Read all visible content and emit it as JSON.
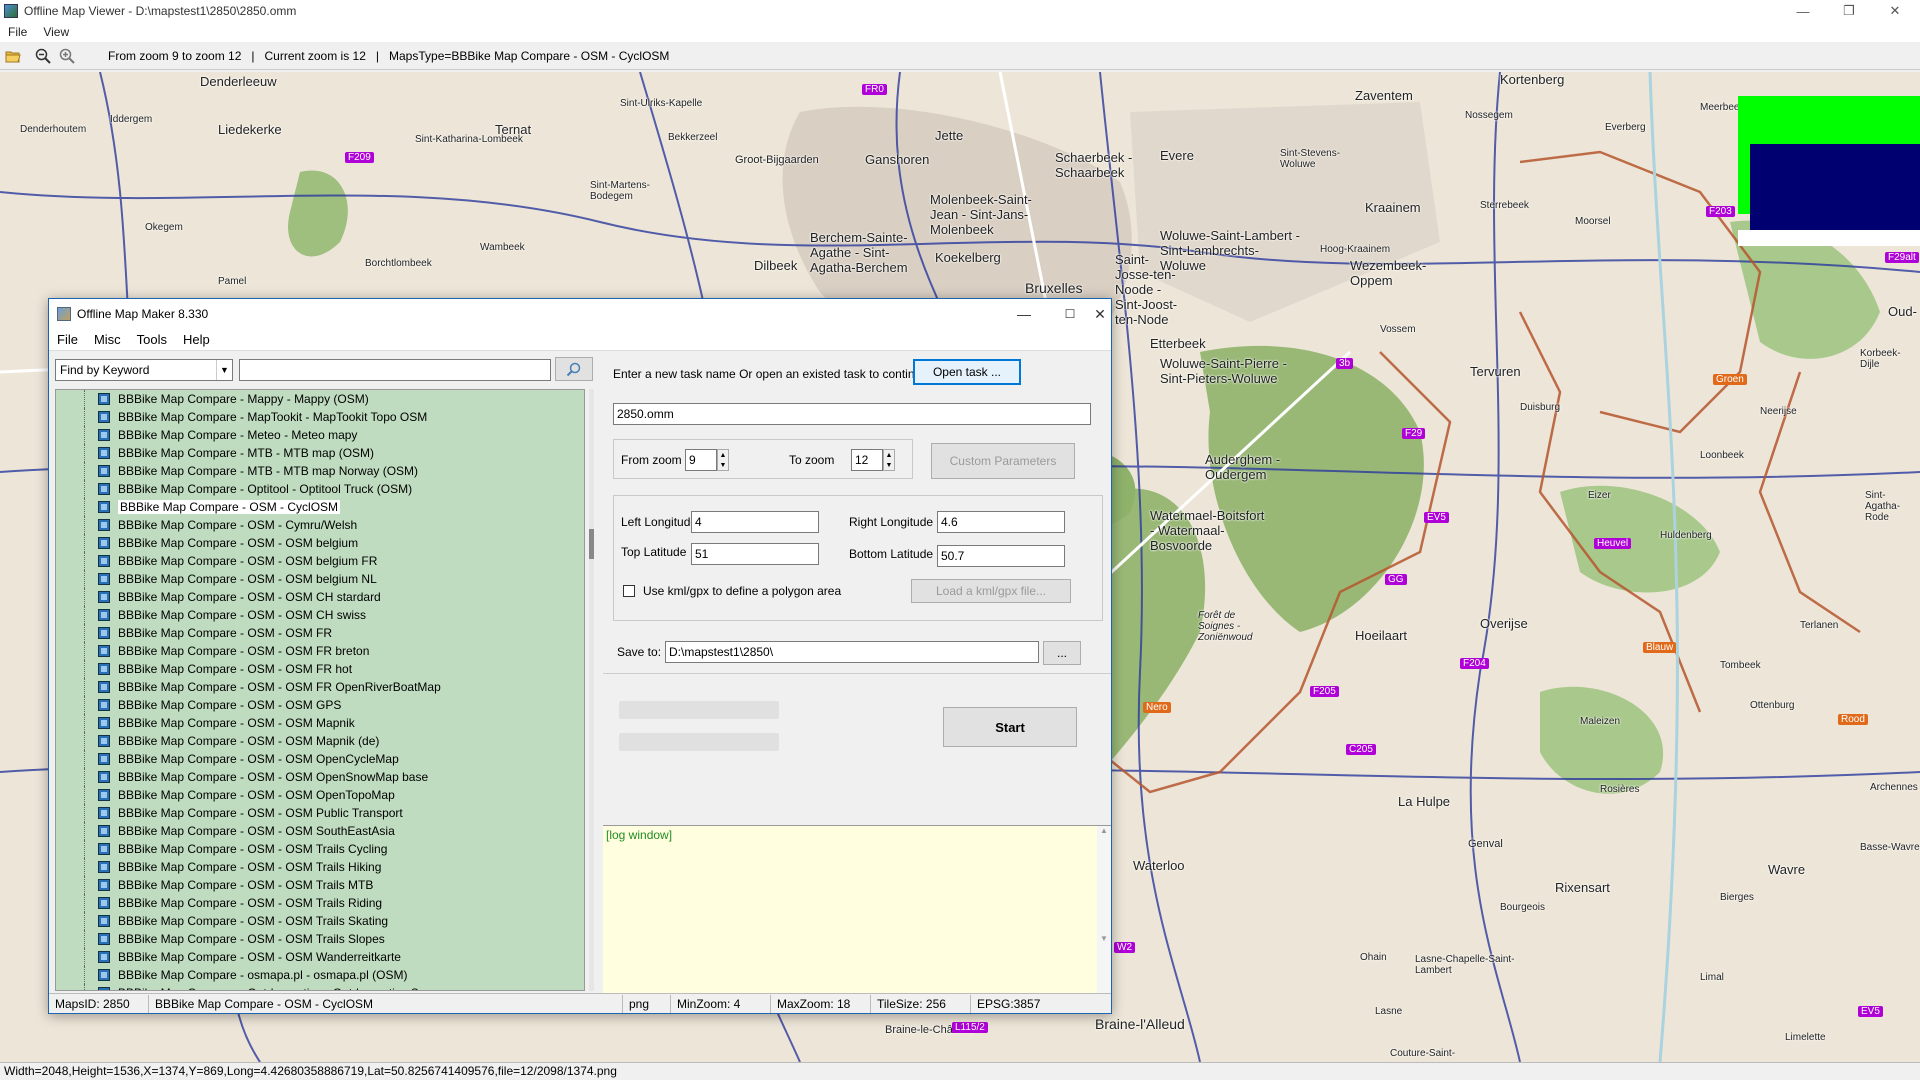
{
  "window": {
    "title": "Offline Map Viewer - D:\\mapstest1\\2850\\2850.omm",
    "controls": [
      "minimize-icon",
      "maximize-icon",
      "close-icon"
    ]
  },
  "menubar": [
    "File",
    "View"
  ],
  "toolbar": {
    "icons": [
      "open-folder-icon",
      "zoom-out-icon",
      "zoom-in-icon"
    ],
    "zoom_range": "From zoom 9 to zoom 12",
    "current_zoom": "Current zoom is 12",
    "maps_type": "MapsType=BBBike Map Compare - OSM - CyclOSM"
  },
  "map": {
    "places": [
      "Denderleeuw",
      "Liedekerke",
      "Ternat",
      "Denderhoutem",
      "Iddergem",
      "Okegem",
      "Pamel",
      "Borchtlombeek",
      "Sint-Ulriks-Kapelle",
      "Sint-Katharina-Lombeek",
      "Bekkerzeel",
      "Groot-Bijgaarden",
      "Ganshoren",
      "Jette",
      "Sint-Martens-Bodegem",
      "Wambeek",
      "Dilbeek",
      "Berchem-Sainte-Agathe - Sint-Agatha-Berchem",
      "Molenbeek-Saint-Jean - Sint-Jans-Molenbeek",
      "Koekelberg",
      "Schaerbeek - Schaarbeek",
      "Bruxelles",
      "Evere",
      "Zaventem",
      "Kortenberg",
      "Kraainem",
      "Sint-Stevens-Woluwe",
      "Nossegem",
      "Everberg",
      "Meerbeek",
      "Woluwe-Saint-Lambert - Sint-Lambrechts-Woluwe",
      "Wezembeek-Oppem",
      "Hoog-Kraainem",
      "Sterrebeek",
      "Moorsel",
      "Saint-Josse-ten-Noode - Sint-Joost-ten-Node",
      "Etterbeek",
      "Vossem",
      "Woluwe-Saint-Pierre - Sint-Pieters-Woluwe",
      "Tervuren",
      "Duisburg",
      "Auderghem - Oudergem",
      "Watermael-Boitsfort - Watermaal-Bosvoorde",
      "Hoeilaart",
      "Overijse",
      "Huldenberg",
      "Neerijse",
      "Loonbeek",
      "Eizer",
      "Forêt de Soignes - Zoniënwoud",
      "Tombeek",
      "Ottenburg",
      "La Hulpe",
      "Genval",
      "Waterloo",
      "Rixensart",
      "Wavre",
      "Braine-l'Alleud",
      "Maleizen",
      "Rosières",
      "Bourgeois",
      "Ohain",
      "Lasne-Chapelle-Saint-Lambert",
      "Limal",
      "Bierges",
      "Limelette",
      "Couture-Saint-",
      "Lasne",
      "Braine-le-Château",
      "Terlanen",
      "Sint-Agatha-Rode",
      "Basse-Wavre",
      "Archennes",
      "Korbeek-Dijle",
      "Oud-"
    ],
    "route_badges": [
      "F209",
      "FR0",
      "F203",
      "F29",
      "EV5",
      "GG",
      "F204",
      "F205",
      "C205",
      "F29alt",
      "3b",
      "Heuvel",
      "Groen",
      "Nero",
      "Blauw",
      "Rood",
      "L115/2",
      "EV5",
      "W2"
    ],
    "colors": {
      "land": "#ede6d8",
      "forest": "#8fb26b",
      "water": "#aad3df",
      "road": "#ffffff",
      "cycle_route": "#2b3a9e",
      "node_route": "#b5562e",
      "badge": "#b000d8"
    }
  },
  "overlay": {
    "green": "#00ff00",
    "navy": "#000070"
  },
  "status": "Width=2048,Height=1536,X=1374,Y=869,Long=4.42680358886719,Lat=50.8256741409576,file=12/2098/1374.png",
  "dialog": {
    "title": "Offline Map Maker 8.330",
    "controls": [
      "minimize-icon",
      "maximize-icon",
      "close-icon"
    ],
    "menu": [
      "File",
      "Misc",
      "Tools",
      "Help"
    ],
    "find_mode": "Find by Keyword",
    "search_value": "",
    "map_list": [
      "BBBike Map Compare - Mappy - Mappy (OSM)",
      "BBBike Map Compare - MapTookit - MapTookit Topo OSM",
      "BBBike Map Compare - Meteo - Meteo mapy",
      "BBBike Map Compare - MTB - MTB map (OSM)",
      "BBBike Map Compare - MTB - MTB map Norway (OSM)",
      "BBBike Map Compare - Optitool - Optitool Truck (OSM)",
      "BBBike Map Compare - OSM - CyclOSM",
      "BBBike Map Compare - OSM - Cymru/Welsh",
      "BBBike Map Compare - OSM - OSM belgium",
      "BBBike Map Compare - OSM - OSM belgium FR",
      "BBBike Map Compare - OSM - OSM belgium NL",
      "BBBike Map Compare - OSM - OSM CH stardard",
      "BBBike Map Compare - OSM - OSM CH swiss",
      "BBBike Map Compare - OSM - OSM FR",
      "BBBike Map Compare - OSM - OSM FR breton",
      "BBBike Map Compare - OSM - OSM FR hot",
      "BBBike Map Compare - OSM - OSM FR OpenRiverBoatMap",
      "BBBike Map Compare - OSM - OSM GPS",
      "BBBike Map Compare - OSM - OSM Mapnik",
      "BBBike Map Compare - OSM - OSM Mapnik (de)",
      "BBBike Map Compare - OSM - OSM OpenCycleMap",
      "BBBike Map Compare - OSM - OSM OpenSnowMap base",
      "BBBike Map Compare - OSM - OSM OpenTopoMap",
      "BBBike Map Compare - OSM - OSM Public Transport",
      "BBBike Map Compare - OSM - OSM SouthEastAsia",
      "BBBike Map Compare - OSM - OSM Trails Cycling",
      "BBBike Map Compare - OSM - OSM Trails Hiking",
      "BBBike Map Compare - OSM - OSM Trails MTB",
      "BBBike Map Compare - OSM - OSM Trails Riding",
      "BBBike Map Compare - OSM - OSM Trails Skating",
      "BBBike Map Compare - OSM - OSM Trails Slopes",
      "BBBike Map Compare - OSM - OSM Wanderreitkarte",
      "BBBike Map Compare - osmapa.pl - osmapa.pl (OSM)",
      "BBBike Map Compare - Outdooractive - Outdooractive Summer"
    ],
    "selected_index": 6,
    "list_bg": "#c0dcc0",
    "task_prompt": "Enter a new task name Or open an existed task to continue:",
    "open_task_label": "Open task ...",
    "task_name": "2850.omm",
    "from_zoom_label": "From zoom",
    "from_zoom": "9",
    "to_zoom_label": "To zoom",
    "to_zoom": "12",
    "custom_params_label": "Custom Parameters",
    "left_lon_label": "Left Longitude",
    "left_lon": "4",
    "right_lon_label": "Right Longitude",
    "right_lon": "4.6",
    "top_lat_label": "Top Latitude",
    "top_lat": "51",
    "bottom_lat_label": "Bottom Latitude",
    "bottom_lat": "50.7",
    "kml_label": "Use kml/gpx to define a polygon area",
    "kml_checked": false,
    "load_kml_label": "Load a kml/gpx file...",
    "save_to_label": "Save to:",
    "save_to": "D:\\mapstest1\\2850\\",
    "browse_label": "...",
    "start_label": "Start",
    "progress_1": 0,
    "progress_2": 0,
    "log": "[log window]",
    "status": {
      "maps_id": "MapsID: 2850",
      "name": "BBBike Map Compare - OSM - CyclOSM",
      "format": "png",
      "min_zoom": "MinZoom: 4",
      "max_zoom": "MaxZoom: 18",
      "tile_size": "TileSize: 256",
      "epsg": "EPSG:3857"
    }
  }
}
